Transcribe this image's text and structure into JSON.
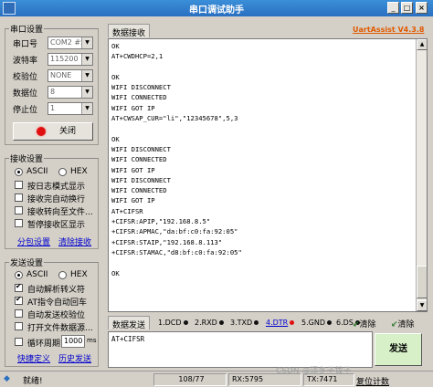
{
  "window": {
    "title": "串口调试助手",
    "min": "_",
    "max": "□",
    "close": "×"
  },
  "serial_settings": {
    "title": "串口设置",
    "port_label": "串口号",
    "port_value": "COM2 #Sil",
    "baud_label": "波特率",
    "baud_value": "115200",
    "parity_label": "校验位",
    "parity_value": "NONE",
    "databits_label": "数据位",
    "databits_value": "8",
    "stopbits_label": "停止位",
    "stopbits_value": "1",
    "close_button": "关闭"
  },
  "receive_settings": {
    "title": "接收设置",
    "ascii": "ASCII",
    "hex": "HEX",
    "options": [
      "按日志模式显示",
      "接收完自动换行",
      "接收转向至文件...",
      "暂停接收区显示"
    ],
    "link_split": "分包设置",
    "link_clear": "清除接收"
  },
  "send_settings": {
    "title": "发送设置",
    "ascii": "ASCII",
    "hex": "HEX",
    "options": [
      "自动解析转义符",
      "AT指令自动回车",
      "自动发送校验位",
      "打开文件数据源..."
    ],
    "cycle_label": "循环周期",
    "cycle_value": "1000",
    "cycle_unit": "ms",
    "link_shortcut": "快捷定义",
    "link_history": "历史发送"
  },
  "receive_panel": {
    "tab": "数据接收",
    "brand": "UartAssist V4.3.8",
    "lines": [
      "OK",
      "AT+CWDHCP=2,1",
      "",
      "OK",
      "WIFI DISCONNECT",
      "WIFI CONNECTED",
      "WIFI GOT IP",
      "AT+CWSAP_CUR=\"li\",\"12345678\",5,3",
      "",
      "OK",
      "WIFI DISCONNECT",
      "WIFI CONNECTED",
      "WIFI GOT IP",
      "WIFI DISCONNECT",
      "WIFI CONNECTED",
      "WIFI GOT IP",
      "AT+CIFSR",
      "+CIFSR:APIP,\"192.168.8.5\"",
      "+CIFSR:APMAC,\"da:bf:c0:fa:92:05\"",
      "+CIFSR:STAIP,\"192.168.8.113\"",
      "+CIFSR:STAMAC,\"d8:bf:c0:fa:92:05\"",
      "",
      "OK"
    ]
  },
  "send_panel": {
    "tab": "数据发送",
    "pins": [
      "1.DCD",
      "2.RXD",
      "3.TXD",
      "4.DTR",
      "5.GND",
      "6.DS"
    ],
    "clear1": "清除",
    "clear2": "清除",
    "input_value": "AT+CIFSR",
    "send_button": "发送"
  },
  "status": {
    "ready": "就绪!",
    "count": "108/77",
    "rx": "RX:5795",
    "tx": "TX:7471",
    "reset": "复位计数",
    "watermark": "CSDN @泽冬子拨子"
  },
  "colors": {
    "titlebar": "#2a6fc0",
    "brand": "#e05a00",
    "close_led": "#e01010",
    "send_btn": "#d7f0c8"
  }
}
